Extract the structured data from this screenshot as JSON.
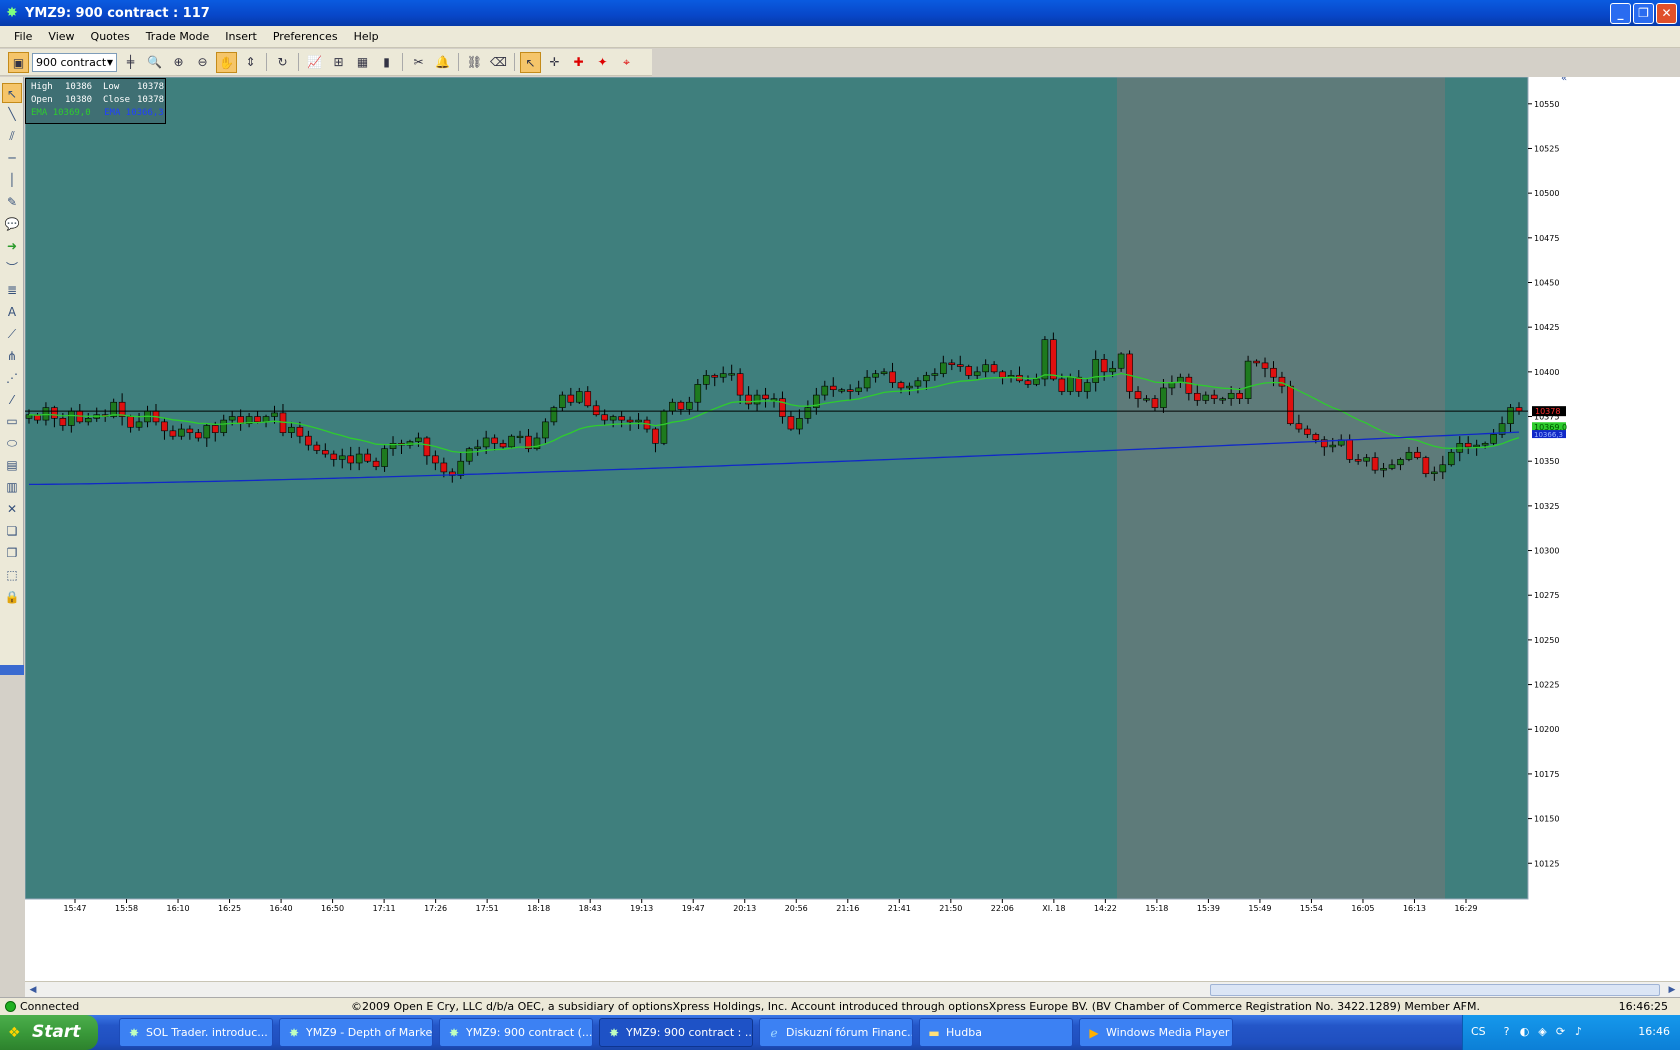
{
  "window": {
    "title": "YMZ9: 900 contract : 117",
    "buttons": [
      "_",
      "❐",
      "✕"
    ]
  },
  "menu": [
    "File",
    "View",
    "Quotes",
    "Trade Mode",
    "Insert",
    "Preferences",
    "Help"
  ],
  "toolbar": {
    "contract": "900 contract"
  },
  "ohlc": {
    "high_label": "High",
    "high": "10386",
    "low_label": "Low",
    "low": "10378",
    "open_label": "Open",
    "open": "10380",
    "close_label": "Close",
    "close": "10378",
    "ema1_label": "EMA",
    "ema1": "10369,0",
    "ema2_label": "EMA",
    "ema2": "10366,3"
  },
  "colors": {
    "session_bg": "#3f7f7d",
    "shaded_bg": "#5e7b7a",
    "up_candle": "#1e7a1e",
    "down_candle": "#e01010",
    "ema_fast": "#2ecc2e",
    "ema_slow": "#1028c8"
  },
  "chart_data": {
    "type": "candlestick",
    "title": "YMZ9: 900 contract : 117",
    "ylim": [
      10105,
      10565
    ],
    "y_ticks": [
      10125,
      10150,
      10175,
      10200,
      10225,
      10250,
      10275,
      10300,
      10325,
      10350,
      10375,
      10400,
      10425,
      10450,
      10475,
      10500,
      10525,
      10550
    ],
    "x_ticks": [
      "15:47",
      "15:58",
      "16:10",
      "16:25",
      "16:40",
      "16:50",
      "17:11",
      "17:26",
      "17:51",
      "18:18",
      "18:43",
      "19:13",
      "19:47",
      "20:13",
      "20:56",
      "21:16",
      "21:41",
      "21:50",
      "22:06",
      "XI. 18",
      "14:22",
      "15:18",
      "15:39",
      "15:49",
      "15:54",
      "16:05",
      "16:13",
      "16:29"
    ],
    "last_price": 10378,
    "last_price_label": "10378",
    "ema_fast_value": 10369.0,
    "ema_fast_label": "10369,0",
    "ema_slow_value": 10366.3,
    "ema_slow_label": "10366,3",
    "close": [
      10376,
      10373,
      10380,
      10374,
      10370,
      10378,
      10372,
      10374,
      10376,
      10375,
      10383,
      10375,
      10369,
      10372,
      10378,
      10372,
      10367,
      10364,
      10368,
      10366,
      10363,
      10370,
      10366,
      10373,
      10375,
      10371,
      10375,
      10372,
      10375,
      10377,
      10366,
      10369,
      10364,
      10359,
      10356,
      10354,
      10351,
      10353,
      10349,
      10354,
      10350,
      10347,
      10357,
      10360,
      10359,
      10361,
      10363,
      10353,
      10349,
      10344,
      10342,
      10350,
      10357,
      10358,
      10363,
      10360,
      10358,
      10364,
      10364,
      10357,
      10363,
      10372,
      10380,
      10387,
      10383,
      10389,
      10381,
      10376,
      10373,
      10375,
      10373,
      10372,
      10373,
      10368,
      10360,
      10378,
      10383,
      10379,
      10383,
      10393,
      10398,
      10397,
      10399,
      10399,
      10387,
      10382,
      10387,
      10385,
      10385,
      10375,
      10368,
      10374,
      10380,
      10387,
      10392,
      10390,
      10390,
      10389,
      10391,
      10397,
      10399,
      10400,
      10394,
      10391,
      10392,
      10395,
      10398,
      10399,
      10405,
      10404,
      10403,
      10398,
      10400,
      10404,
      10400,
      10397,
      10398,
      10395,
      10393,
      10396,
      10418,
      10396,
      10389,
      10397,
      10389,
      10394,
      10407,
      10400,
      10402,
      10410,
      10389,
      10385,
      10385,
      10380,
      10391,
      10394,
      10397,
      10388,
      10384,
      10387,
      10385,
      10385,
      10388,
      10385,
      10406,
      10405,
      10402,
      10397,
      10392,
      10371,
      10368,
      10365,
      10362,
      10358,
      10359,
      10362,
      10351,
      10350,
      10352,
      10345,
      10346,
      10348,
      10351,
      10355,
      10352,
      10343,
      10344,
      10348,
      10355,
      10360,
      10358,
      10359,
      10360,
      10365,
      10371,
      10380,
      10378
    ]
  },
  "status": {
    "connection": "Connected",
    "copyright": "©2009 Open E Cry, LLC d/b/a OEC, a subsidiary of optionsXpress Holdings, Inc. Account introduced through optionsXpress Europe BV. (BV Chamber of Commerce Registration No. 3422.1289) Member AFM.",
    "time": "16:46:25"
  },
  "taskbar": {
    "start": "Start",
    "tasks": [
      "SOL Trader. introduc...",
      "YMZ9 - Depth of Market",
      "YMZ9: 900 contract (...",
      "YMZ9: 900 contract : ...",
      "Diskuzní fórum Financ...",
      "Hudba",
      "Windows Media Player"
    ],
    "tray_lang": "CS",
    "clock": "16:46"
  }
}
